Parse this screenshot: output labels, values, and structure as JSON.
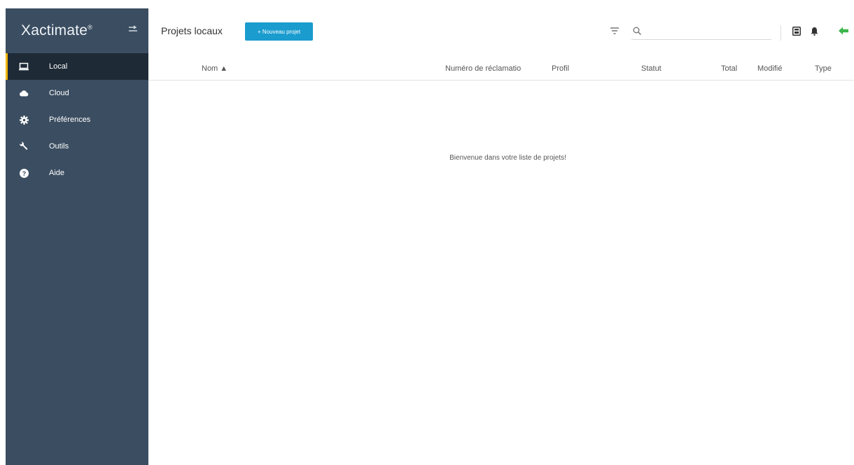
{
  "brand": {
    "name": "Xactimate",
    "superscript": "®"
  },
  "sidebar": {
    "items": [
      {
        "label": "Local",
        "icon": "laptop-icon",
        "active": true
      },
      {
        "label": "Cloud",
        "icon": "cloud-icon",
        "active": false
      },
      {
        "label": "Préférences",
        "icon": "gear-icon",
        "active": false
      },
      {
        "label": "Outils",
        "icon": "wrench-icon",
        "active": false
      },
      {
        "label": "Aide",
        "icon": "help-icon",
        "active": false
      }
    ]
  },
  "header": {
    "title": "Projets locaux",
    "new_project_label": "+ Nouveau projet",
    "search": {
      "value": ""
    }
  },
  "table": {
    "columns": [
      "Nom ▲",
      "Numéro de réclamatio",
      "Profil",
      "Statut",
      "Total",
      "Modifié",
      "Type"
    ]
  },
  "empty_state": {
    "title": "Bienvenue dans votre liste de projets!"
  },
  "colors": {
    "sidebar_bg": "#3b4d61",
    "sidebar_active_bg": "#1e2a36",
    "active_accent": "#f0b400",
    "primary": "#1a9ccf",
    "sync_green": "#3cb54a"
  }
}
